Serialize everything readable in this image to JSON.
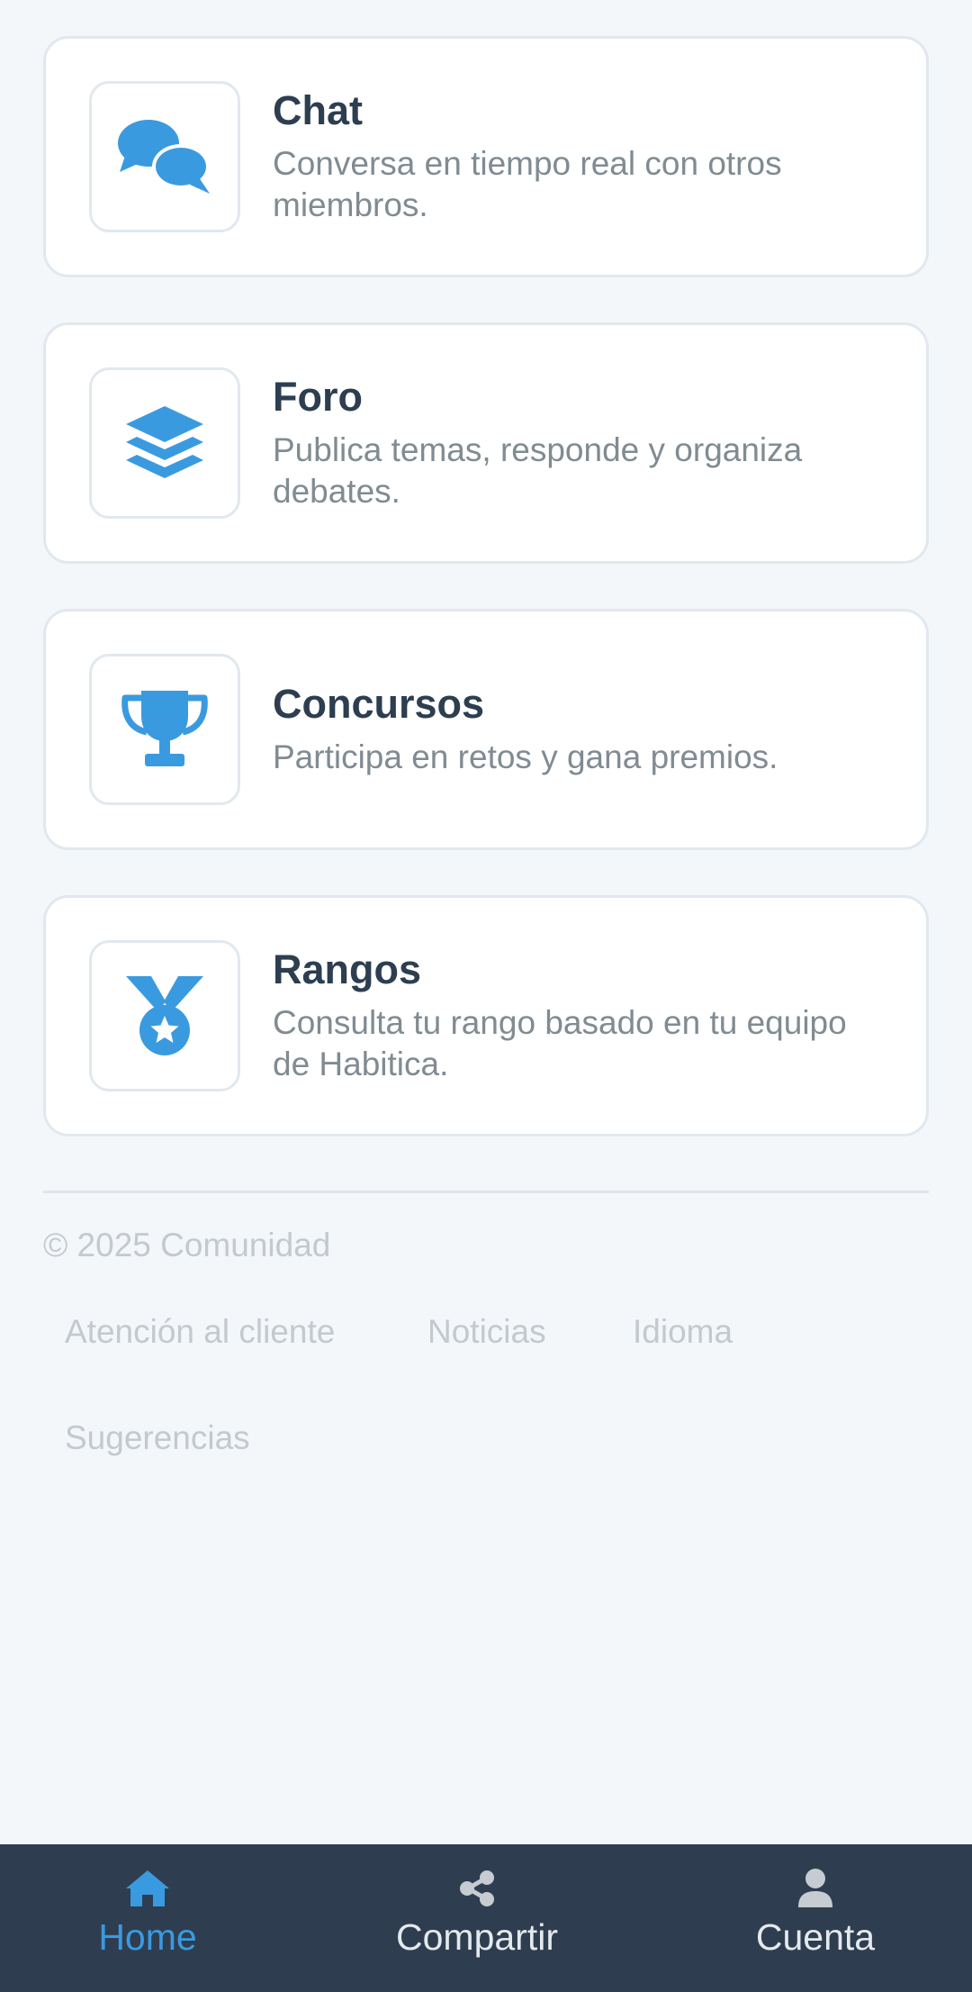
{
  "colors": {
    "accent": "#3a9ae0",
    "background": "#f4f7fa",
    "nav_background": "#2e3e50",
    "title_text": "#2c3e50",
    "muted_text": "#808b92"
  },
  "cards": [
    {
      "icon": "chat-bubbles-icon",
      "title": "Chat",
      "description": "Conversa en tiempo real con otros miembros."
    },
    {
      "icon": "layers-icon",
      "title": "Foro",
      "description": "Publica temas, responde y organiza debates."
    },
    {
      "icon": "trophy-icon",
      "title": "Concursos",
      "description": "Participa en retos y gana premios."
    },
    {
      "icon": "medal-icon",
      "title": "Rangos",
      "description": "Consulta tu rango basado en tu equipo de Habitica."
    }
  ],
  "footer": {
    "copyright": "© 2025 Comunidad",
    "links": [
      "Atención al cliente",
      "Noticias",
      "Idioma",
      "Sugerencias"
    ]
  },
  "bottom_nav": {
    "active": "Home",
    "items": [
      {
        "icon": "home-icon",
        "label": "Home"
      },
      {
        "icon": "share-icon",
        "label": "Compartir"
      },
      {
        "icon": "user-icon",
        "label": "Cuenta"
      }
    ]
  }
}
